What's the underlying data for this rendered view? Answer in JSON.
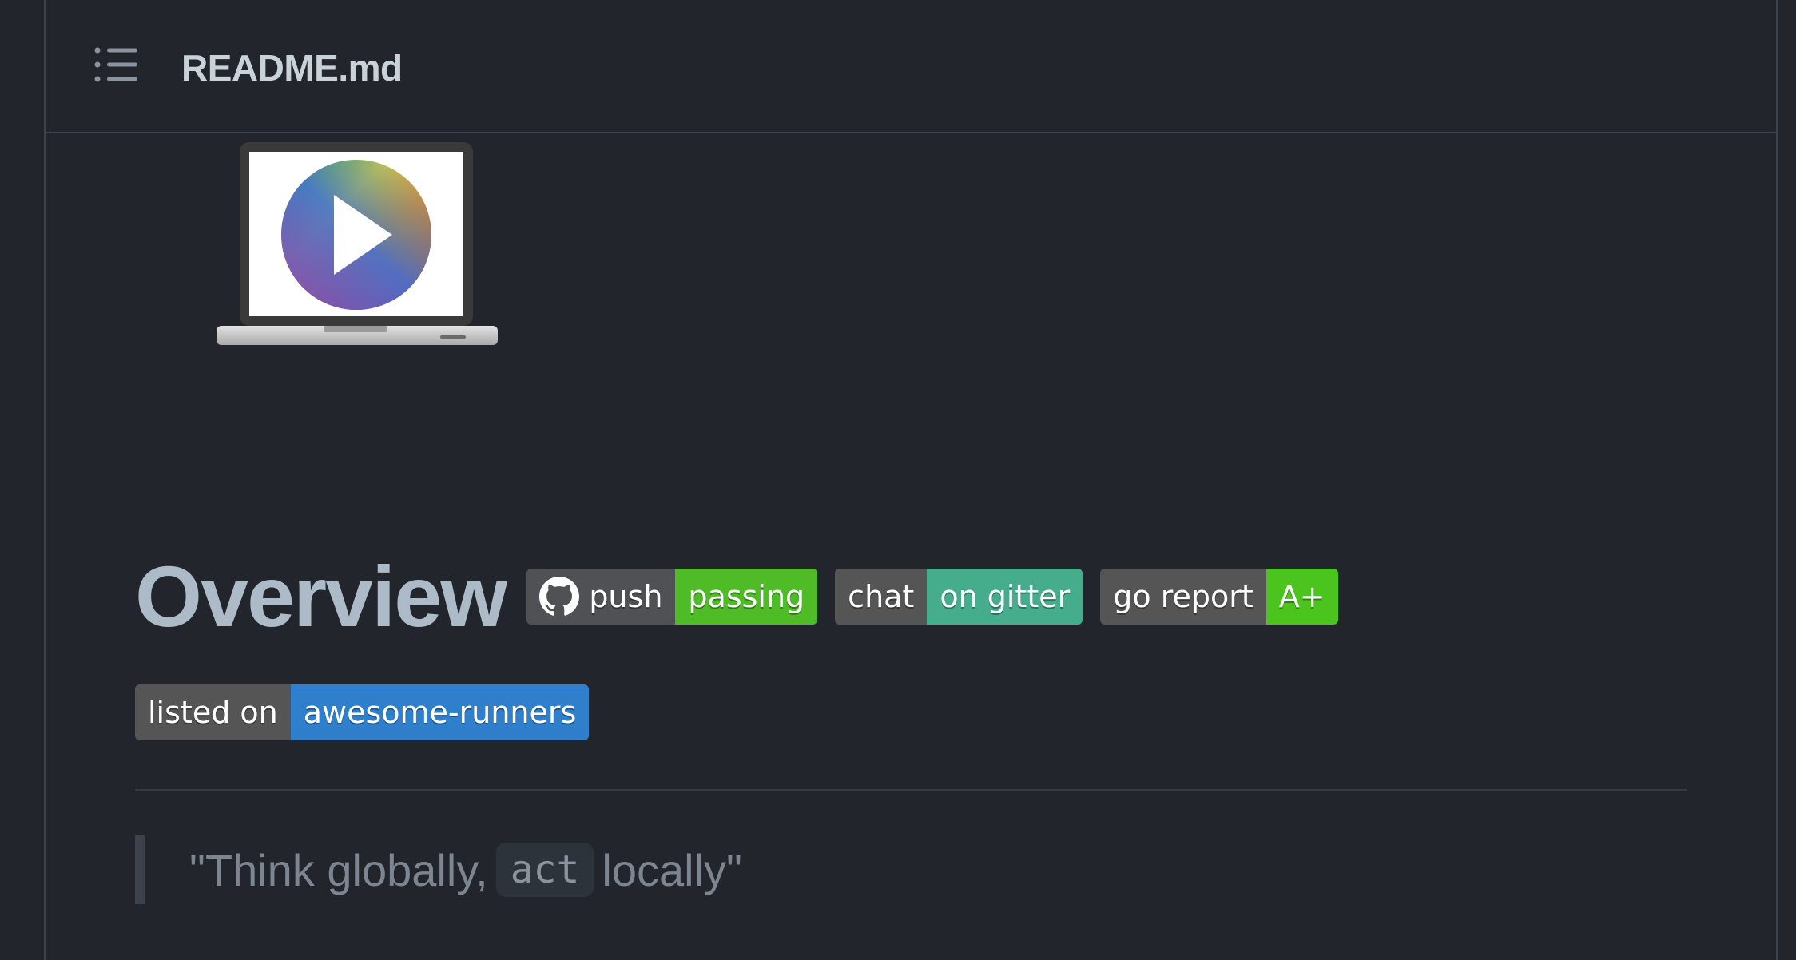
{
  "file_header": {
    "title": "README.md",
    "toc_icon": "list-unordered-icon"
  },
  "hero": {
    "image": "laptop-play-button-logo"
  },
  "overview": {
    "heading": "Overview",
    "badges": [
      {
        "left": "push",
        "right": "passing",
        "icon": "github-icon",
        "color": "#4fbb26"
      },
      {
        "left": "chat",
        "right": "on gitter",
        "color": "#46ad8c"
      },
      {
        "left": "go report",
        "right": "A+",
        "color": "#4bc51d"
      },
      {
        "left": "listed on",
        "right": "awesome-runners",
        "color": "#2f7fcd"
      }
    ]
  },
  "quote": {
    "before": "\"Think globally,",
    "code": "act",
    "after": "locally\""
  },
  "colors": {
    "background": "#22262c",
    "border": "#3d444d"
  }
}
